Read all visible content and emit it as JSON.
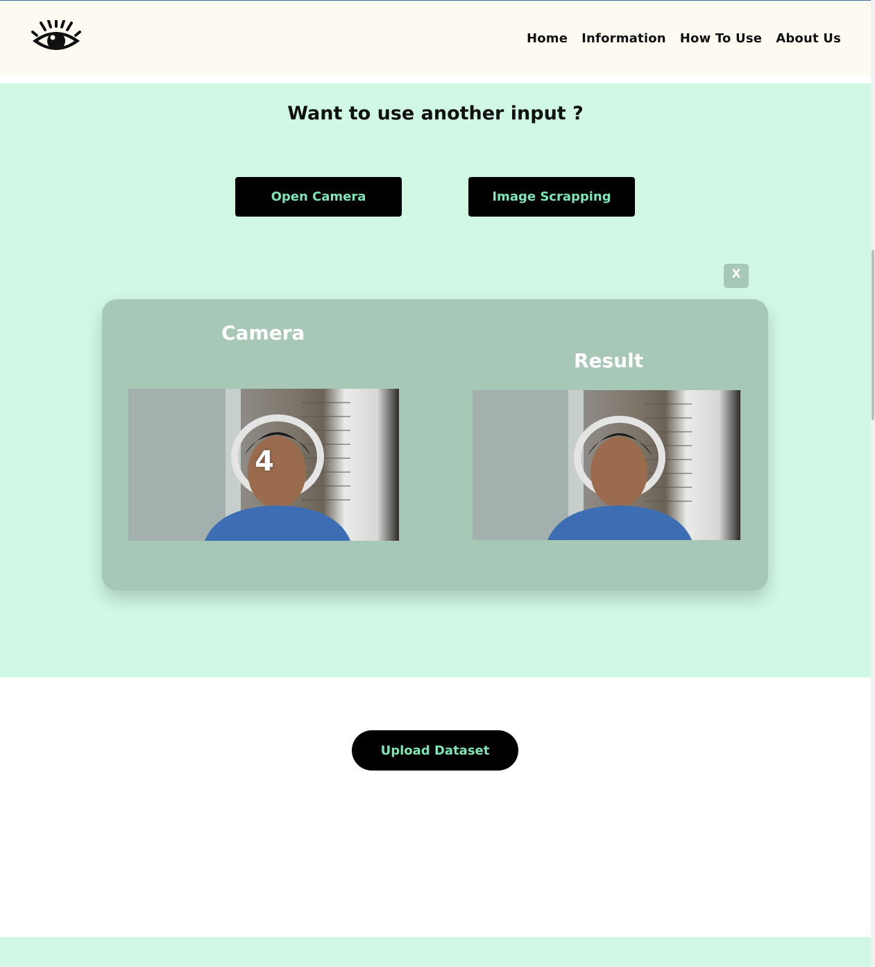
{
  "nav": {
    "items": [
      {
        "label": "Home"
      },
      {
        "label": "Information"
      },
      {
        "label": "How To Use"
      },
      {
        "label": "About Us"
      }
    ]
  },
  "section": {
    "heading": "Want to use another input ?",
    "open_camera_label": "Open Camera",
    "image_scrapping_label": "Image Scrapping",
    "close_label": "X"
  },
  "camera_panel": {
    "camera_title": "Camera",
    "result_title": "Result",
    "countdown": "4"
  },
  "upload": {
    "label": "Upload Dataset"
  },
  "colors": {
    "header_bg": "#fdfaf1",
    "section_bg": "#d0f8e4",
    "card_bg": "#a8c8b7",
    "button_bg": "#000000",
    "button_text": "#7ee6b6"
  },
  "icons": {
    "logo": "eye-icon"
  }
}
